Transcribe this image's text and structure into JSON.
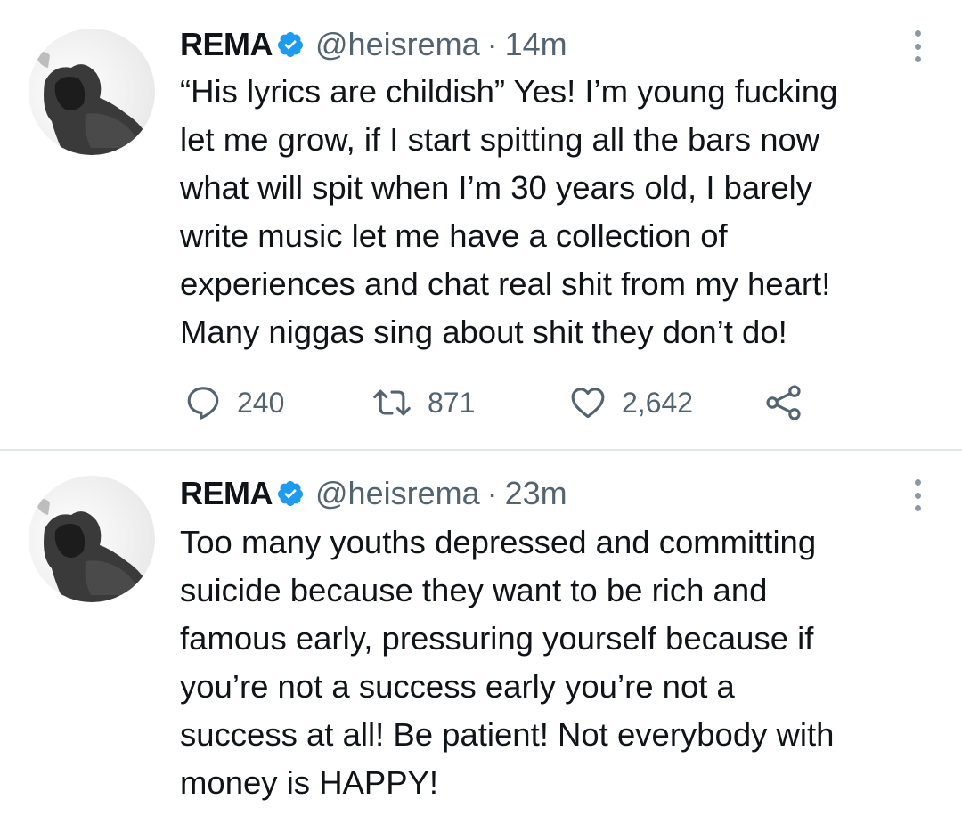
{
  "tweets": [
    {
      "author": {
        "name": "REMA",
        "handle": "@heisrema",
        "verified": true,
        "avatar_icon": "profile-photo-grayscale"
      },
      "separator": "·",
      "time": "14m",
      "text_lines": [
        "“His lyrics are childish” Yes! I’m young fucking",
        "let me grow, if I start spitting all the bars now",
        "what will spit when I’m 30 years old, I barely",
        "write music let me have a collection of",
        "experiences and chat real shit from my heart!",
        "Many niggas sing about shit they don’t do!"
      ],
      "actions": {
        "reply_count": "240",
        "retweet_count": "871",
        "like_count": "2,642"
      }
    },
    {
      "author": {
        "name": "REMA",
        "handle": "@heisrema",
        "verified": true,
        "avatar_icon": "profile-photo-grayscale"
      },
      "separator": "·",
      "time": "23m",
      "text_lines": [
        "Too many youths depressed and committing",
        "suicide because they want to be rich and",
        "famous early, pressuring yourself because if",
        "you’re not a success early you’re not a",
        "success at all! Be patient! Not everybody with",
        "money is HAPPY!"
      ]
    }
  ],
  "colors": {
    "verified_badge": "#1d9bf0",
    "text_primary": "#0f1419",
    "text_secondary": "#536471",
    "divider": "#e3e6e8"
  }
}
